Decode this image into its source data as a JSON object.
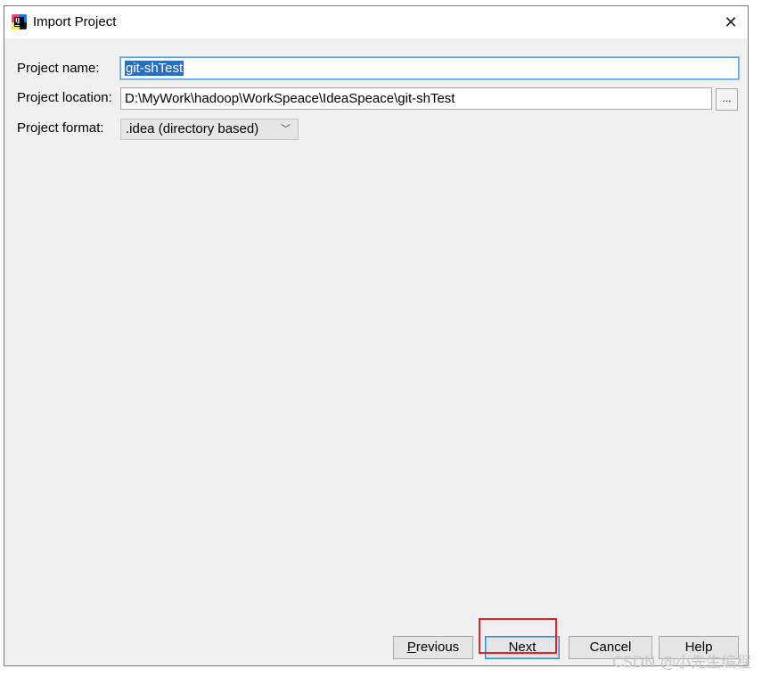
{
  "window": {
    "title": "Import Project",
    "close_glyph": "✕",
    "app_icon_text": "IJ"
  },
  "form": {
    "name_label": "Project name:",
    "name_value": "git-shTest",
    "location_label": "Project location:",
    "location_value": "D:\\MyWork\\hadoop\\WorkSpeace\\IdeaSpeace\\git-shTest",
    "browse_label": "...",
    "format_label": "Project format:",
    "format_value": ".idea (directory based)",
    "format_chevron": "﹀"
  },
  "buttons": {
    "previous_mnemonic": "P",
    "previous_rest": "revious",
    "next_mnemonic": "N",
    "next_rest": "ext",
    "cancel": "Cancel",
    "help": "Help"
  },
  "watermark": "CSDN @小先生编程",
  "colors": {
    "selection": "#2a6fbd",
    "highlight": "#e52020",
    "focus": "#5a9fd8"
  }
}
